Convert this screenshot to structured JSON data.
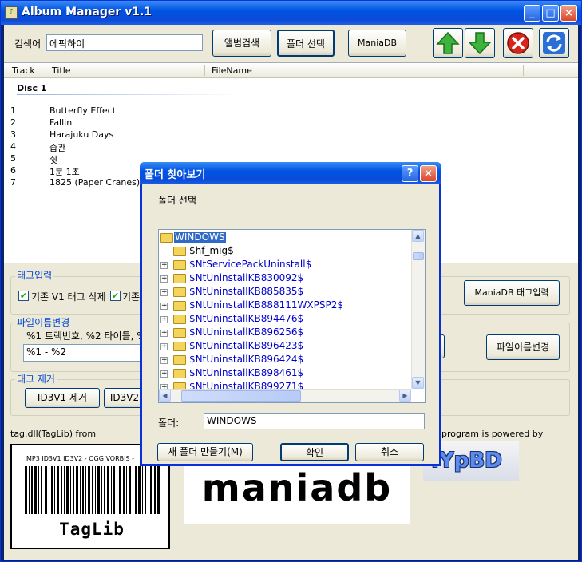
{
  "app": {
    "title": "Album Manager v1.1",
    "icon": "music-note-icon"
  },
  "search": {
    "label": "검색어",
    "value": "에픽하이"
  },
  "toolbar": {
    "album_search": "앨범검색",
    "folder_select": "폴더 선택",
    "maniadb": "ManiaDB",
    "up_icon": "green-up-arrow-icon",
    "down_icon": "green-down-arrow-icon",
    "delete_icon": "red-x-icon",
    "refresh_icon": "refresh-icon"
  },
  "tracks": {
    "columns": [
      "Track",
      "Title",
      "FileName"
    ],
    "disc": "Disc 1",
    "rows": [
      {
        "num": "1",
        "title": "Butterfly Effect"
      },
      {
        "num": "2",
        "title": "Fallin"
      },
      {
        "num": "3",
        "title": "Harajuku Days"
      },
      {
        "num": "4",
        "title": "습관"
      },
      {
        "num": "5",
        "title": "쉿"
      },
      {
        "num": "6",
        "title": "1분 1초"
      },
      {
        "num": "7",
        "title": "1825 (Paper Cranes)"
      }
    ]
  },
  "tag_input": {
    "group": "태그입력",
    "cb1": "기존 V1 태그 삭제",
    "cb2": "기존",
    "button": "ManiaDB 태그입력"
  },
  "rename": {
    "group": "파일이름변경",
    "hint": "%1 트랙번호, %2 타이틀, %",
    "pattern": "%1 - %2",
    "button": "파일이름변경"
  },
  "tag_remove": {
    "group": "태그 제거",
    "btn1": "ID3V1 제거",
    "btn2": "ID3V2"
  },
  "footer": {
    "taglib_credit": "tag.dll(TagLib) from",
    "powered": "program is powered by",
    "barcode_caption": "MP3 ID3V1 ID3V2 - OGG VORBIS -",
    "taglib_logo": "TagLib",
    "maniadb_logo": "maniadb",
    "ypbd_logo": ".YpBD"
  },
  "dialog": {
    "title": "폴더 찾아보기",
    "instruction": "폴더 선택",
    "help_icon": "help-question-icon",
    "close_icon": "close-icon",
    "tree": [
      "WINDOWS",
      "$hf_mig$",
      "$NtServicePackUninstall$",
      "$NtUninstallKB830092$",
      "$NtUninstallKB885835$",
      "$NtUninstallKB888111WXPSP2$",
      "$NtUninstallKB894476$",
      "$NtUninstallKB896256$",
      "$NtUninstallKB896423$",
      "$NtUninstallKB896424$",
      "$NtUninstallKB898461$",
      "$NtUninstallKB899271$"
    ],
    "folder_label": "폴더:",
    "folder_value": "WINDOWS",
    "new_folder": "새 폴더 만들기(M)",
    "ok": "확인",
    "cancel": "취소"
  }
}
